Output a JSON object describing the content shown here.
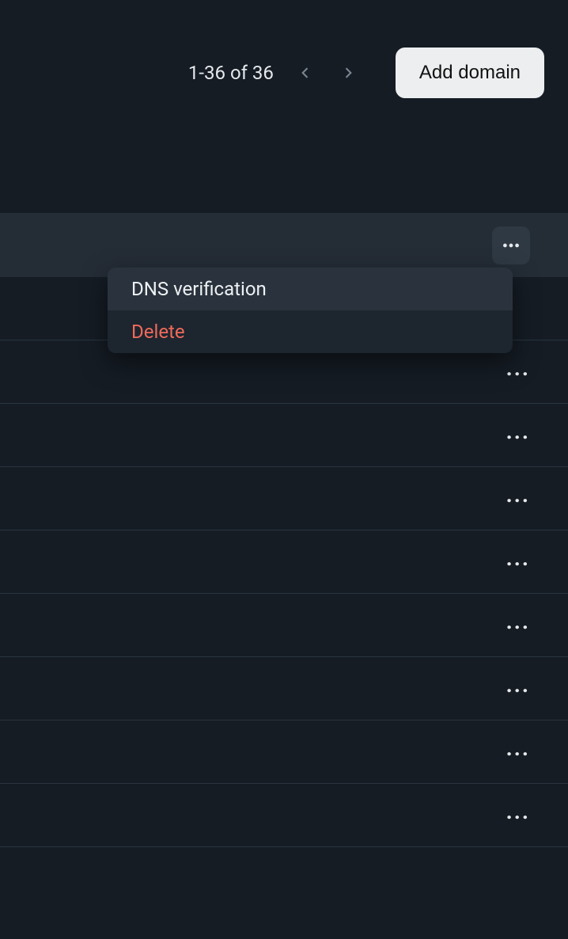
{
  "pagination": {
    "range_text": "1-36 of 36"
  },
  "actions": {
    "add_domain_label": "Add domain"
  },
  "menu": {
    "items": [
      {
        "label": "DNS verification"
      },
      {
        "label": "Delete"
      }
    ]
  }
}
